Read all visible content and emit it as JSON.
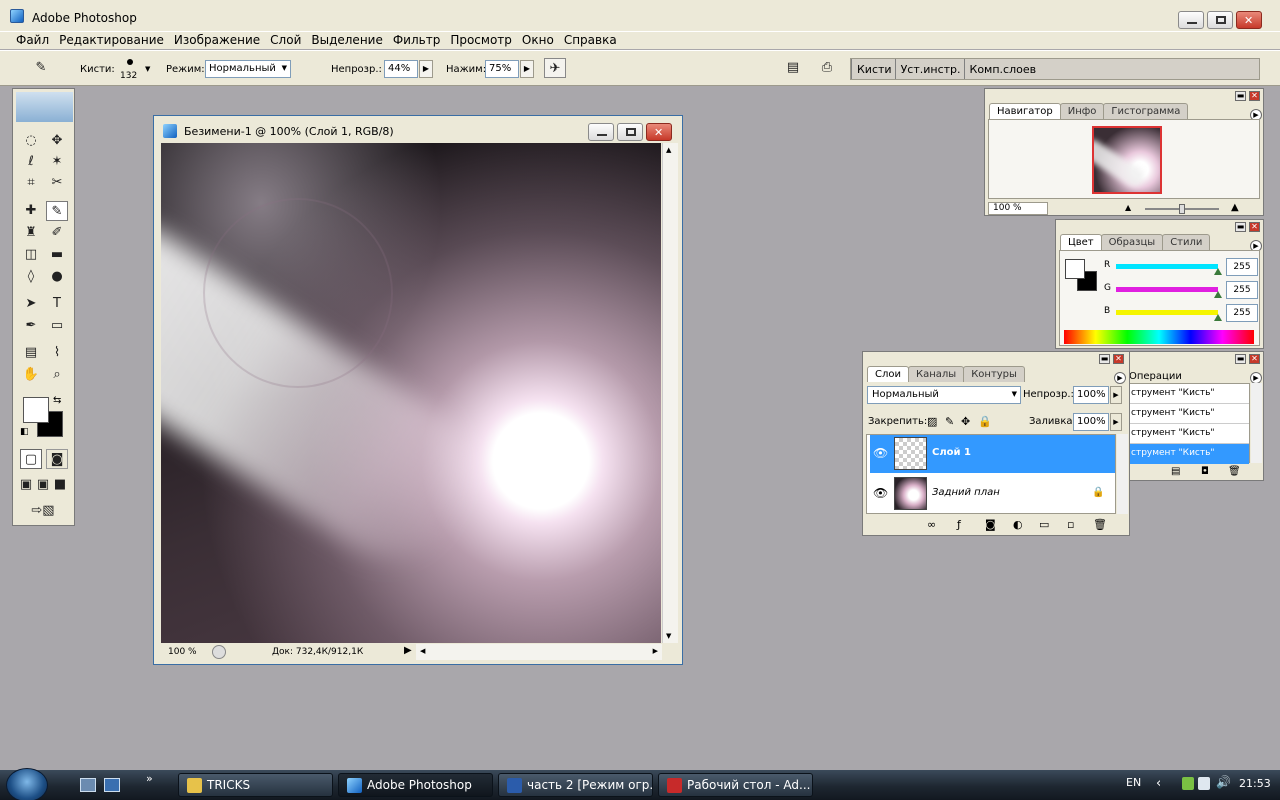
{
  "app": {
    "title": "Adobe Photoshop"
  },
  "menu": [
    "Файл",
    "Редактирование",
    "Изображение",
    "Слой",
    "Выделение",
    "Фильтр",
    "Просмотр",
    "Окно",
    "Справка"
  ],
  "options": {
    "brush_label": "Кисти:",
    "brush_size": "132",
    "mode_label": "Режим:",
    "mode_value": "Нормальный",
    "opacity_label": "Непрозр.:",
    "opacity_value": "44%",
    "flow_label": "Нажим:",
    "flow_value": "75%",
    "well_tabs": [
      "Кисти",
      "Уст.инстр.",
      "Комп.слоев"
    ]
  },
  "document": {
    "title": "Безимени-1 @ 100% (Слой 1, RGB/8)",
    "zoom": "100 %",
    "doc_info": "Док: 732,4К/912,1К"
  },
  "navigator": {
    "tabs": [
      "Навигатор",
      "Инфо",
      "Гистограмма"
    ],
    "zoom": "100 %"
  },
  "color": {
    "tabs": [
      "Цвет",
      "Образцы",
      "Стили"
    ],
    "channels": [
      {
        "label": "R",
        "value": "255",
        "color": "#00e5ff"
      },
      {
        "label": "G",
        "value": "255",
        "color": "#e020e0"
      },
      {
        "label": "B",
        "value": "255",
        "color": "#f5f500"
      }
    ]
  },
  "history": {
    "tab": "Операции",
    "items": [
      "струмент \"Кисть\"",
      "струмент \"Кисть\"",
      "струмент \"Кисть\"",
      "струмент \"Кисть\""
    ]
  },
  "layers": {
    "tabs": [
      "Слои",
      "Каналы",
      "Контуры"
    ],
    "blend_mode": "Нормальный",
    "opacity_label": "Непрозр.:",
    "opacity_value": "100%",
    "lock_label": "Закрепить:",
    "fill_label": "Заливка:",
    "fill_value": "100%",
    "items": [
      {
        "name": "Слой 1",
        "selected": true
      },
      {
        "name": "Задний план",
        "selected": false
      }
    ]
  },
  "taskbar": {
    "tasks": [
      "TRICKS",
      "Adobe Photoshop",
      "часть 2 [Режим огр...",
      "Рабочий стол - Ad..."
    ],
    "lang": "EN",
    "clock": "21:53"
  },
  "colors": {
    "accent": "#3399ff",
    "window_bg": "#ece9d8",
    "workspace": "#a9a7ab"
  }
}
